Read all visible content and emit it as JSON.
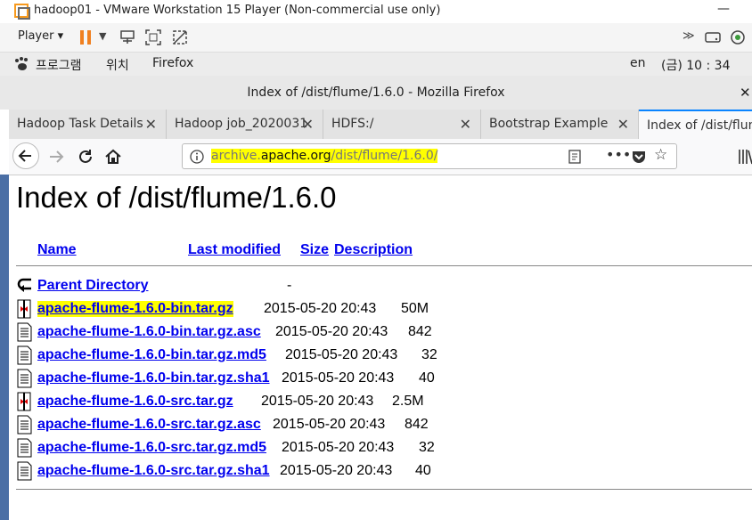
{
  "vm": {
    "title": "hadoop01 - VMware Workstation 15 Player (Non-commercial use only)",
    "player_label": "Player",
    "minimize": "—",
    "close": "✕"
  },
  "gnome": {
    "menu1": "프로그램",
    "menu2": "위치",
    "app": "Firefox",
    "lang": "en",
    "clock": "(금) 10 : 34"
  },
  "firefox": {
    "window_title": "Index of /dist/flume/1.6.0 - Mozilla Firefox",
    "tabs": [
      {
        "label": "Hadoop Task Details"
      },
      {
        "label": "Hadoop job_2020031"
      },
      {
        "label": "HDFS:/"
      },
      {
        "label": "Bootstrap Example"
      },
      {
        "label": "Index of /dist/flum"
      }
    ],
    "url_host_pre": "archive.",
    "url_host": "apache.org",
    "url_path": "/dist/flume/1.6.0/"
  },
  "page": {
    "heading": "Index of /dist/flume/1.6.0",
    "columns": {
      "name": "Name",
      "modified": "Last modified",
      "size": "Size",
      "description": "Description"
    },
    "parent": {
      "name": "Parent Directory",
      "size": "-"
    },
    "files": [
      {
        "name": "apache-flume-1.6.0-bin.tar.gz",
        "modified": "2015-05-20 20:43",
        "size": "50M",
        "icon": "archive-icon",
        "highlight": true
      },
      {
        "name": "apache-flume-1.6.0-bin.tar.gz.asc",
        "modified": "2015-05-20 20:43",
        "size": "842",
        "icon": "text-file-icon"
      },
      {
        "name": "apache-flume-1.6.0-bin.tar.gz.md5",
        "modified": "2015-05-20 20:43",
        "size": "32",
        "icon": "text-file-icon"
      },
      {
        "name": "apache-flume-1.6.0-bin.tar.gz.sha1",
        "modified": "2015-05-20 20:43",
        "size": "40",
        "icon": "text-file-icon"
      },
      {
        "name": "apache-flume-1.6.0-src.tar.gz",
        "modified": "2015-05-20 20:43",
        "size": "2.5M",
        "icon": "archive-icon"
      },
      {
        "name": "apache-flume-1.6.0-src.tar.gz.asc",
        "modified": "2015-05-20 20:43",
        "size": "842",
        "icon": "text-file-icon"
      },
      {
        "name": "apache-flume-1.6.0-src.tar.gz.md5",
        "modified": "2015-05-20 20:43",
        "size": "32",
        "icon": "text-file-icon"
      },
      {
        "name": "apache-flume-1.6.0-src.tar.gz.sha1",
        "modified": "2015-05-20 20:43",
        "size": "40",
        "icon": "text-file-icon"
      }
    ]
  },
  "colors": {
    "link": "#0000ee",
    "highlight": "#ffff00",
    "tab_accent": "#0a84ff"
  }
}
